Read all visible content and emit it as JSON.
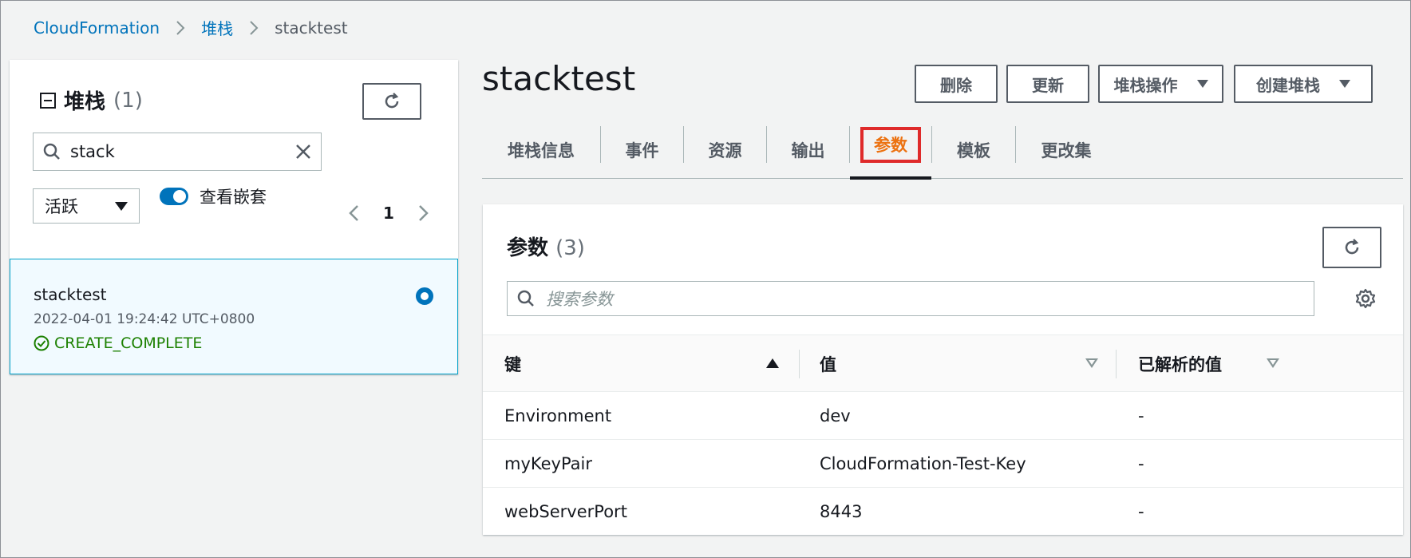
{
  "breadcrumb": {
    "items": [
      "CloudFormation",
      "堆栈",
      "stacktest"
    ]
  },
  "left_panel": {
    "title": "堆栈",
    "count": "(1)",
    "search_value": "stack",
    "filter_select": "活跃",
    "toggle_label": "查看嵌套",
    "toggle_on": true,
    "page_number": "1",
    "stack": {
      "name": "stacktest",
      "created": "2022-04-01 19:24:42 UTC+0800",
      "status": "CREATE_COMPLETE",
      "selected": true
    }
  },
  "header": {
    "title": "stacktest",
    "buttons": {
      "delete": "删除",
      "update": "更新",
      "stack_actions": "堆栈操作",
      "create_stack": "创建堆栈"
    }
  },
  "tabs": [
    {
      "label": "堆栈信息",
      "active": false
    },
    {
      "label": "事件",
      "active": false
    },
    {
      "label": "资源",
      "active": false
    },
    {
      "label": "输出",
      "active": false
    },
    {
      "label": "参数",
      "active": true,
      "highlighted": true
    },
    {
      "label": "模板",
      "active": false
    },
    {
      "label": "更改集",
      "active": false
    }
  ],
  "parameters": {
    "title": "参数",
    "count": "(3)",
    "search_placeholder": "搜索参数",
    "columns": [
      "键",
      "值",
      "已解析的值"
    ],
    "rows": [
      {
        "key": "Environment",
        "value": "dev",
        "resolved": "-"
      },
      {
        "key": "myKeyPair",
        "value": "CloudFormation-Test-Key",
        "resolved": "-"
      },
      {
        "key": "webServerPort",
        "value": "8443",
        "resolved": "-"
      }
    ]
  },
  "colors": {
    "link": "#0073bb",
    "active_tab": "#ec7211",
    "success": "#1d8102",
    "highlight_border": "#df2a2a"
  },
  "icons": [
    "chevron-right-icon",
    "collapse-icon",
    "refresh-icon",
    "search-icon",
    "close-icon",
    "caret-down-icon",
    "chevron-left-icon",
    "radio-selected-icon",
    "success-check-icon",
    "settings-gear-icon",
    "sort-ascending-icon",
    "sort-icon"
  ]
}
